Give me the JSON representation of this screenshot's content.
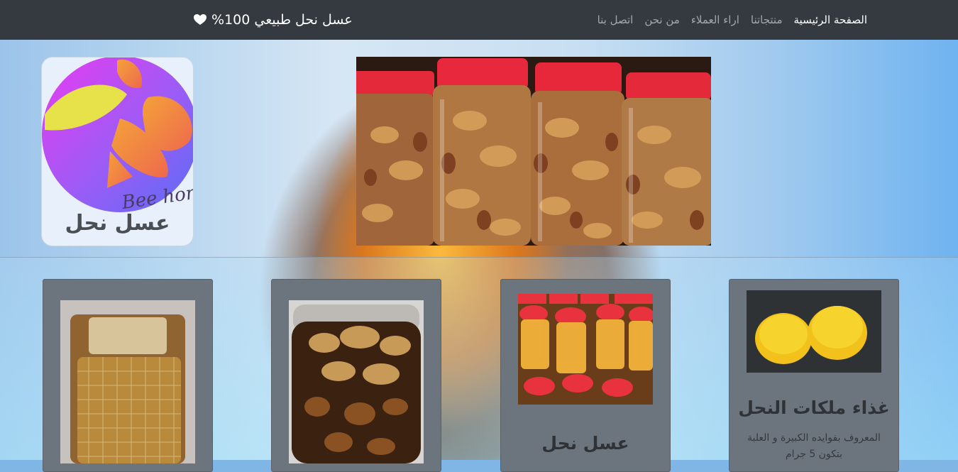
{
  "navbar": {
    "brand": "عسل نحل طبيعي 100%",
    "links": [
      {
        "label": "الصفحة الرئيسية"
      },
      {
        "label": "منتجاتنا"
      },
      {
        "label": "اراء العملاء"
      },
      {
        "label": "من نحن"
      },
      {
        "label": "اتصل بنا"
      }
    ]
  },
  "hero": {
    "logo_watermark": "Bee hon",
    "logo_title": "عسل نحل"
  },
  "cards": [
    {
      "title": "",
      "text": ""
    },
    {
      "title": "",
      "text": ""
    },
    {
      "title": "عسل نحل",
      "text": ""
    },
    {
      "title": "غذاء ملكات النحل",
      "text": "المعروف بفوايده الكبيرة و العلبة بتكون 5 جرام"
    }
  ],
  "colors": {
    "navbar_bg": "#343a40",
    "card_bg": "#6c757d",
    "nav_active": "#ffffff"
  }
}
